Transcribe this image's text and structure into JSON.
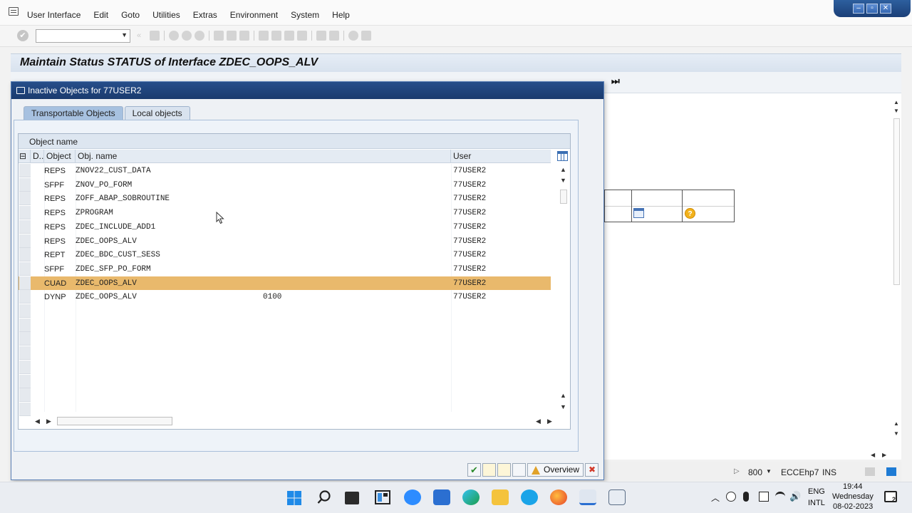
{
  "menu": [
    "User Interface",
    "Edit",
    "Goto",
    "Utilities",
    "Extras",
    "Environment",
    "System",
    "Help"
  ],
  "window_controls": [
    "–",
    "▫",
    "✕"
  ],
  "command_field": {
    "value": ""
  },
  "main_title": "Maintain Status STATUS of Interface ZDEC_OOPS_ALV",
  "dialog": {
    "title": "Inactive Objects for 77USER2",
    "tabs": [
      "Transportable Objects",
      "Local objects"
    ],
    "active_tab": 0,
    "alv_title": "Object name",
    "columns": [
      "D..",
      "Object",
      "Obj. name",
      "User"
    ],
    "rows": [
      {
        "object": "REPS",
        "name": "ZNOV22_CUST_DATA",
        "extra": "",
        "user": "77USER2"
      },
      {
        "object": "SFPF",
        "name": "ZNOV_PO_FORM",
        "extra": "",
        "user": "77USER2"
      },
      {
        "object": "REPS",
        "name": "ZOFF_ABAP_SOBROUTINE",
        "extra": "",
        "user": "77USER2"
      },
      {
        "object": "REPS",
        "name": "ZPROGRAM",
        "extra": "",
        "user": "77USER2"
      },
      {
        "object": "REPS",
        "name": "ZDEC_INCLUDE_ADD1",
        "extra": "",
        "user": "77USER2"
      },
      {
        "object": "REPS",
        "name": "ZDEC_OOPS_ALV",
        "extra": "",
        "user": "77USER2"
      },
      {
        "object": "REPT",
        "name": "ZDEC_BDC_CUST_SESS",
        "extra": "",
        "user": "77USER2"
      },
      {
        "object": "SFPF",
        "name": "ZDEC_SFP_PO_FORM",
        "extra": "",
        "user": "77USER2"
      },
      {
        "object": "CUAD",
        "name": "ZDEC_OOPS_ALV",
        "extra": "",
        "user": "77USER2",
        "highlighted": true
      },
      {
        "object": "DYNP",
        "name": "ZDEC_OOPS_ALV",
        "extra": "0100",
        "user": "77USER2"
      }
    ],
    "overview_label": "Overview"
  },
  "status_bar": {
    "client": "800",
    "system": "ECCEhp7",
    "mode": "INS"
  },
  "taskbar": {
    "language": "ENG",
    "keyboard": "INTL",
    "time": "19:44",
    "day": "Wednesday",
    "date": "08-02-2023",
    "notification_count": "2"
  },
  "colors": {
    "highlight_row": "#e9b96c",
    "dialog_title": "#1f4580",
    "tab_active": "#a7c1e0"
  }
}
